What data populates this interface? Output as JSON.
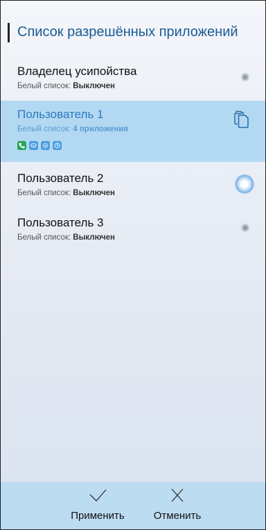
{
  "header": {
    "title": "Список разрешённых приложений"
  },
  "users": [
    {
      "name": "Владелец усипойства",
      "whitelist_prefix": "Белый список: ",
      "whitelist_value": "Выключен",
      "toggle": "off"
    },
    {
      "name": "Пользователь 1",
      "whitelist_prefix": "Белый список: ",
      "whitelist_value": "4 приложения",
      "selected": true,
      "apps": [
        "phone-app-icon",
        "messages-app-icon",
        "settings-app-icon",
        "clock-app-icon"
      ]
    },
    {
      "name": "Пользователь 2",
      "whitelist_prefix": "Белый список: ",
      "whitelist_value": "Выключен",
      "toggle": "focused"
    },
    {
      "name": "Пользователь 3",
      "whitelist_prefix": "Белый список: ",
      "whitelist_value": "Выключен",
      "toggle": "off"
    }
  ],
  "actions": {
    "apply_label": "Применить",
    "cancel_label": "Отменить"
  },
  "colors": {
    "accent": "#1a5b94",
    "selected_row": "#b3d8f2",
    "bottom_bar": "#bcdcf1",
    "phone_icon": "#27a55a",
    "app_icon": "#4a9fe0"
  }
}
